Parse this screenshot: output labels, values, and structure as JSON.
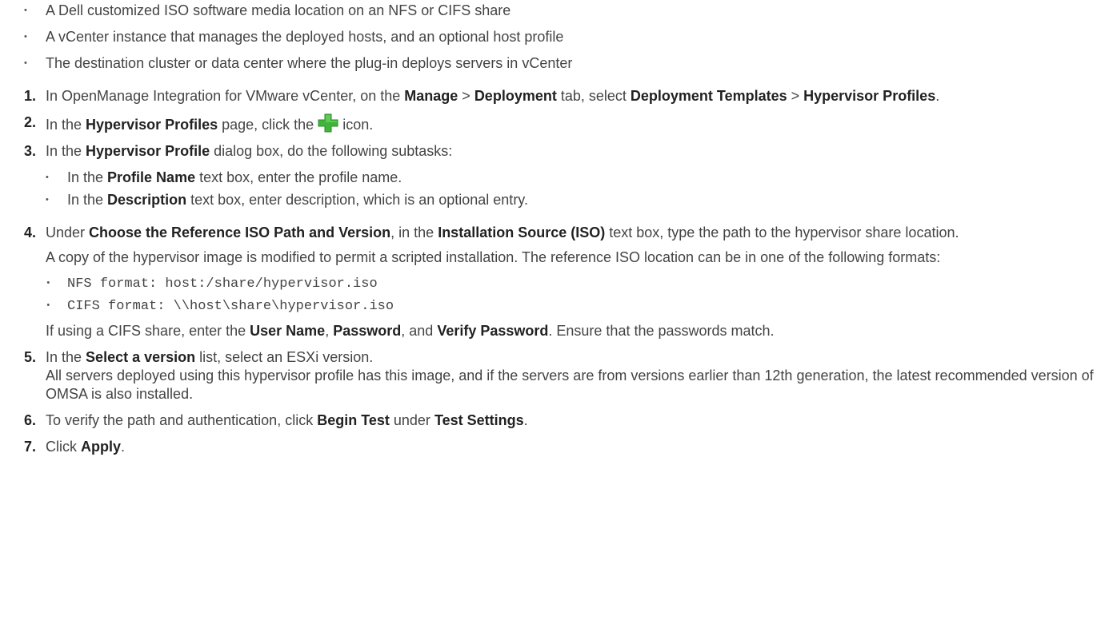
{
  "prereqs": [
    "A Dell customized ISO software media location on an NFS or CIFS share",
    "A vCenter instance that manages the deployed hosts, and an optional host profile",
    "The destination cluster or data center where the plug-in deploys servers in vCenter"
  ],
  "step1": {
    "num": "1.",
    "t1": "In OpenManage Integration for VMware vCenter, on the ",
    "b1": "Manage",
    "t2": " > ",
    "b2": "Deployment",
    "t3": " tab, select ",
    "b3": "Deployment Templates",
    "t4": " > ",
    "b4": "Hypervisor Profiles",
    "t5": "."
  },
  "step2": {
    "num": "2.",
    "t1": "In the ",
    "b1": "Hypervisor Profiles",
    "t2": " page, click the ",
    "t3": " icon.",
    "icon": "add-plus-icon",
    "icon_color": "#3fb53a"
  },
  "step3": {
    "num": "3.",
    "t1": "In the ",
    "b1": "Hypervisor Profile",
    "t2": " dialog box, do the following subtasks:",
    "sub1": {
      "t1": "In the ",
      "b1": "Profile Name",
      "t2": " text box, enter the profile name."
    },
    "sub2": {
      "t1": "In the ",
      "b1": "Description",
      "t2": " text box, enter description, which is an optional entry."
    }
  },
  "step4": {
    "num": "4.",
    "t1": "Under ",
    "b1": "Choose the Reference ISO Path and Version",
    "t2": ", in the ",
    "b2": "Installation Source (ISO)",
    "t3": " text box, type the path to the hypervisor share location.",
    "para1": "A copy of the hypervisor image is modified to permit a scripted installation. The reference ISO location can be in one of the following formats:",
    "code1": "NFS format: host:/share/hypervisor.iso",
    "code2": "CIFS format: \\\\host\\share\\hypervisor.iso",
    "p2_t1": "If using a CIFS share, enter the ",
    "p2_b1": "User Name",
    "p2_t2": ", ",
    "p2_b2": "Password",
    "p2_t3": ", and ",
    "p2_b3": "Verify Password",
    "p2_t4": ". Ensure that the passwords match."
  },
  "step5": {
    "num": "5.",
    "t1": "In the ",
    "b1": "Select a version",
    "t2": " list, select an ESXi version.",
    "para": "All servers deployed using this hypervisor profile has this image, and if the servers are from versions earlier than 12th generation, the latest recommended version of OMSA is also installed."
  },
  "step6": {
    "num": "6.",
    "t1": "To verify the path and authentication, click ",
    "b1": "Begin Test",
    "t2": " under ",
    "b2": "Test Settings",
    "t3": "."
  },
  "step7": {
    "num": "7.",
    "t1": "Click ",
    "b1": "Apply",
    "t2": "."
  }
}
